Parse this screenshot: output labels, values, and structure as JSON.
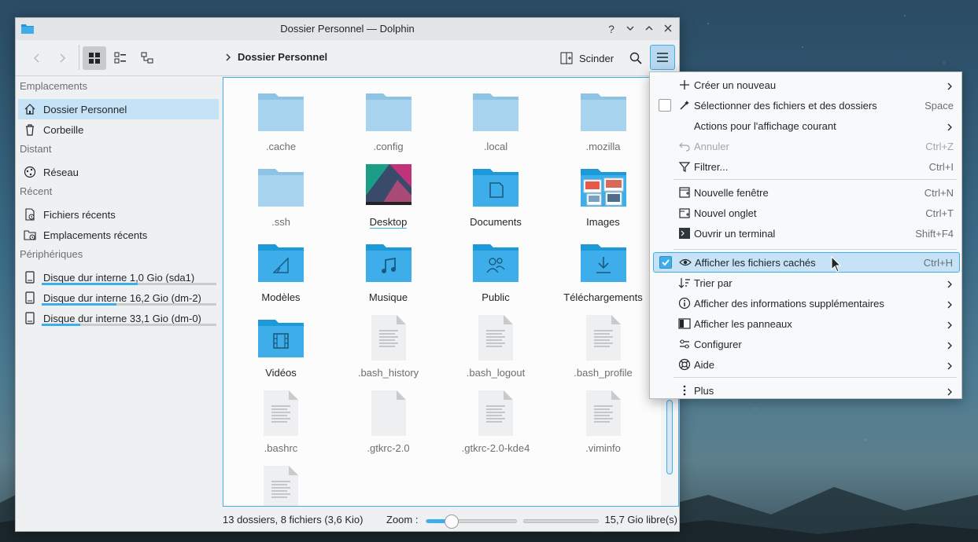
{
  "window": {
    "title": "Dossier Personnel — Dolphin"
  },
  "titlebar": {
    "help": "?",
    "minimize": "⌄",
    "maximize": "⌃",
    "close": "✕"
  },
  "toolbar": {
    "breadcrumb": "Dossier Personnel",
    "split_label": "Scinder"
  },
  "sidebar": {
    "sections": [
      {
        "title": "Emplacements",
        "items": [
          {
            "label": "Dossier Personnel",
            "icon": "home-icon",
            "selected": true
          },
          {
            "label": "Corbeille",
            "icon": "trash-icon"
          }
        ]
      },
      {
        "title": "Distant",
        "items": [
          {
            "label": "Réseau",
            "icon": "network-icon"
          }
        ]
      },
      {
        "title": "Récent",
        "items": [
          {
            "label": "Fichiers récents",
            "icon": "recent-files-icon"
          },
          {
            "label": "Emplacements récents",
            "icon": "recent-locations-icon"
          }
        ]
      },
      {
        "title": "Périphériques",
        "items": [
          {
            "label": "Disque dur interne 1,0 Gio (sda1)",
            "icon": "harddisk-icon",
            "usage": 0.55
          },
          {
            "label": "Disque dur interne 16,2 Gio (dm-2)",
            "icon": "harddisk-icon",
            "usage": 0.43
          },
          {
            "label": "Disque dur interne 33,1 Gio (dm-0)",
            "icon": "harddisk-icon",
            "usage": 0.22
          }
        ]
      }
    ]
  },
  "files": [
    {
      "name": ".cache",
      "type": "folder-hidden"
    },
    {
      "name": ".config",
      "type": "folder-hidden"
    },
    {
      "name": ".local",
      "type": "folder-hidden"
    },
    {
      "name": ".mozilla",
      "type": "folder-hidden"
    },
    {
      "name": ".ssh",
      "type": "folder-hidden"
    },
    {
      "name": "Desktop",
      "type": "desktop"
    },
    {
      "name": "Documents",
      "type": "folder-documents"
    },
    {
      "name": "Images",
      "type": "folder-images"
    },
    {
      "name": "Modèles",
      "type": "folder-templates"
    },
    {
      "name": "Musique",
      "type": "folder-music"
    },
    {
      "name": "Public",
      "type": "folder-public"
    },
    {
      "name": "Téléchargements",
      "type": "folder-downloads"
    },
    {
      "name": "Vidéos",
      "type": "folder-videos"
    },
    {
      "name": ".bash_history",
      "type": "text-file"
    },
    {
      "name": ".bash_logout",
      "type": "text-file"
    },
    {
      "name": ".bash_profile",
      "type": "text-file"
    },
    {
      "name": ".bashrc",
      "type": "text-file"
    },
    {
      "name": ".gtkrc-2.0",
      "type": "blank-file"
    },
    {
      "name": ".gtkrc-2.0-kde4",
      "type": "text-file"
    },
    {
      "name": ".viminfo",
      "type": "text-file"
    },
    {
      "name": "",
      "type": "text-file"
    }
  ],
  "statusbar": {
    "summary": "13 dossiers, 8 fichiers (3,6 Kio)",
    "zoom_label": "Zoom :",
    "zoom_level": 0.28,
    "free_space": "15,7 Gio libre(s)",
    "used_fraction": 0.0
  },
  "menu": {
    "items": [
      {
        "label": "Créer un nouveau",
        "icon": "plus-icon",
        "submenu": true
      },
      {
        "label": "Sélectionner des fichiers et des dossiers",
        "icon": "selection-icon",
        "shortcut": "Space",
        "checkbox": false
      },
      {
        "label": "Actions pour l'affichage courant",
        "icon": "",
        "submenu": true
      },
      {
        "label": "Annuler",
        "icon": "undo-icon",
        "shortcut": "Ctrl+Z",
        "disabled": true
      },
      {
        "label": "Filtrer...",
        "icon": "filter-icon",
        "shortcut": "Ctrl+I"
      },
      {
        "separator": true
      },
      {
        "label": "Nouvelle fenêtre",
        "icon": "new-window-icon",
        "shortcut": "Ctrl+N"
      },
      {
        "label": "Nouvel onglet",
        "icon": "new-tab-icon",
        "shortcut": "Ctrl+T"
      },
      {
        "label": "Ouvrir un terminal",
        "icon": "terminal-icon",
        "shortcut": "Shift+F4"
      },
      {
        "separator": true
      },
      {
        "label": "Afficher les fichiers cachés",
        "icon": "eye-icon",
        "shortcut": "Ctrl+H",
        "checkbox": true,
        "highlight": true
      },
      {
        "label": "Trier par",
        "icon": "sort-icon",
        "submenu": true
      },
      {
        "label": "Afficher des informations supplémentaires",
        "icon": "info-icon",
        "submenu": true
      },
      {
        "label": "Afficher les panneaux",
        "icon": "panels-icon",
        "submenu": true
      },
      {
        "label": "Configurer",
        "icon": "configure-icon",
        "submenu": true
      },
      {
        "label": "Aide",
        "icon": "help-icon",
        "submenu": true
      },
      {
        "separator": true
      },
      {
        "label": "Plus",
        "icon": "more-icon",
        "submenu": true
      }
    ]
  },
  "colors": {
    "accent": "#3daee9",
    "folder": "#3daee9",
    "folder_dark": "#1d99d9",
    "folder_hidden": "#a8d4ef"
  }
}
